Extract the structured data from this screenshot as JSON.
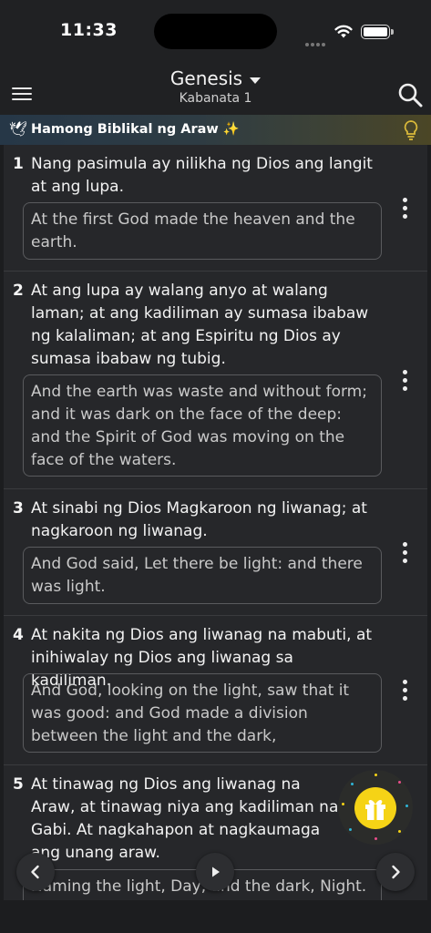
{
  "status": {
    "time": "11:33"
  },
  "header": {
    "book": "Genesis",
    "chapter": "Kabanata 1"
  },
  "banner": {
    "text": "Hamong Biblikal ng Araw ✨"
  },
  "verses": [
    {
      "num": "1",
      "text": "Nang pasimula ay nilikha ng Dios ang langit at ang lupa.",
      "translation": "At the first God made the heaven and the earth."
    },
    {
      "num": "2",
      "text": "At ang lupa ay walang anyo at walang laman; at ang kadiliman ay sumasa ibabaw ng kalaliman; at ang Espiritu ng Dios ay sumasa ibabaw ng tubig.",
      "translation": "And the earth was waste and without form; and it was dark on the face of the deep: and the Spirit of God was moving on the face of the waters."
    },
    {
      "num": "3",
      "text": "At sinabi ng Dios Magkaroon ng liwanag; at nagkaroon ng liwanag.",
      "translation": "And God said, Let there be light: and there was light."
    },
    {
      "num": "4",
      "text": "At nakita ng Dios ang liwanag na mabuti, at inihiwalay ng Dios ang liwanag sa kadiliman.",
      "translation": "And God, looking on the light, saw that it was good: and God made a division between the light and the dark,"
    },
    {
      "num": "5",
      "text": "At tinawag ng Dios ang liwanag na Araw, at tinawag niya ang kadiliman na Gabi. At nagkahapon at nagkaumaga ang unang araw.",
      "translation": "Naming the light, Day, and the dark, Night."
    }
  ],
  "icons": {
    "menu": "hamburger-icon",
    "search": "search-icon",
    "banner": "dove-icon",
    "hint": "lightbulb-icon",
    "more": "more-vertical-icon",
    "gift": "gift-icon",
    "prev": "chevron-left-icon",
    "play": "play-icon",
    "next": "chevron-right-icon"
  },
  "colors": {
    "accent": "#f5d316",
    "background": "#1c1d1f",
    "card": "#26272a"
  }
}
